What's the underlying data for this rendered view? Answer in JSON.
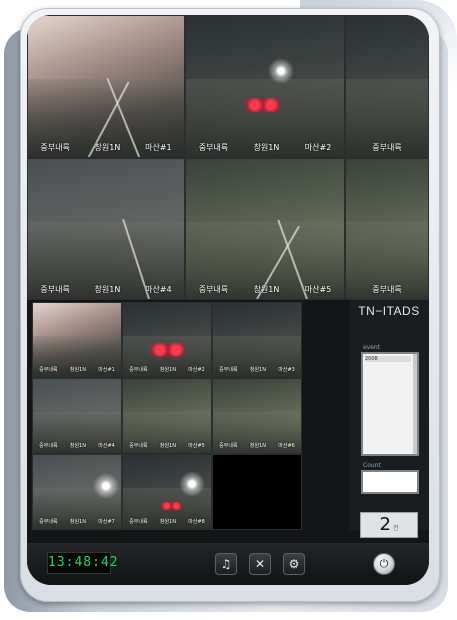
{
  "panel": {
    "title": "TN−ITADS",
    "list_label": "event",
    "list_first_item": "2008",
    "input_label": "Count",
    "counter_value": "2",
    "counter_unit": "건"
  },
  "clock": "13:48:42",
  "cams_large": [
    {
      "road": "중부내륙",
      "loc": "창원1N",
      "cam": "마산#1"
    },
    {
      "road": "중부내륙",
      "loc": "창원1N",
      "cam": "마산#2"
    },
    {
      "road": "중부내륙",
      "loc": "",
      "cam": ""
    },
    {
      "road": "중부내륙",
      "loc": "창원1N",
      "cam": "마산#4"
    },
    {
      "road": "중부내륙",
      "loc": "창원1N",
      "cam": "마산#5"
    },
    {
      "road": "중부내륙",
      "loc": "",
      "cam": ""
    }
  ],
  "cams_small": [
    {
      "road": "중부내륙",
      "loc": "창원1N",
      "cam": "마산#1"
    },
    {
      "road": "중부내륙",
      "loc": "창원1N",
      "cam": "마산#2"
    },
    {
      "road": "중부내륙",
      "loc": "창원1N",
      "cam": "마산#3"
    },
    {
      "road": "중부내륙",
      "loc": "창원1N",
      "cam": "마산#4"
    },
    {
      "road": "중부내륙",
      "loc": "창원1N",
      "cam": "마산#5"
    },
    {
      "road": "중부내륙",
      "loc": "창원1N",
      "cam": "마산#6"
    },
    {
      "road": "중부내륙",
      "loc": "창원1N",
      "cam": "마산#7"
    },
    {
      "road": "중부내륙",
      "loc": "창원1N",
      "cam": "마산#8"
    }
  ],
  "icons": {
    "music": "music-note-icon",
    "tools": "tools-icon",
    "settings": "gears-icon",
    "power": "power-icon"
  }
}
